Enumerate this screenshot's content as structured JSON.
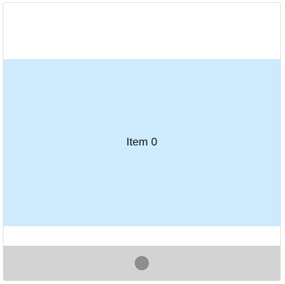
{
  "carousel": {
    "items": [
      {
        "label": "Item 0"
      }
    ],
    "active_index": 0
  },
  "colors": {
    "item_background": "#cdebfd",
    "pager_background": "#d3d3d3",
    "dot_active": "#8e8e8e"
  }
}
